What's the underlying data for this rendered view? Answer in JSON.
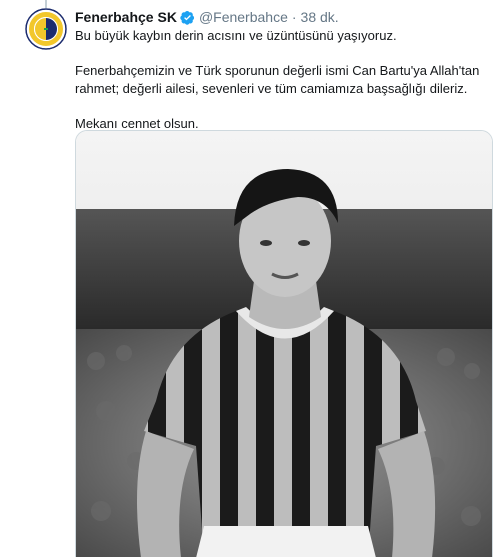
{
  "tweet": {
    "author_name": "Fenerbahçe SK",
    "verified": true,
    "handle": "@Fenerbahce",
    "separator": "·",
    "time": "38 dk.",
    "paragraphs": [
      "Bu büyük kaybın derin acısını ve üzüntüsünü yaşıyoruz.",
      "Fenerbahçemizin ve Türk sporunun değerli ismi Can Bartu'ya Allah'tan rahmet; değerli ailesi, sevenleri ve tüm camiamıza başsağlığı dileriz.",
      "Mekanı cennet olsun."
    ],
    "media": {
      "kind": "black-and-white-photo",
      "subject": "footballer-in-striped-jersey"
    }
  },
  "colors": {
    "text": "#14171a",
    "secondary_text": "#657786",
    "verified_blue": "#1da1f2",
    "club_navy": "#1c2c6e",
    "club_yellow": "#f2c72b"
  },
  "icons": [
    "verified-badge-icon",
    "club-crest-icon"
  ]
}
